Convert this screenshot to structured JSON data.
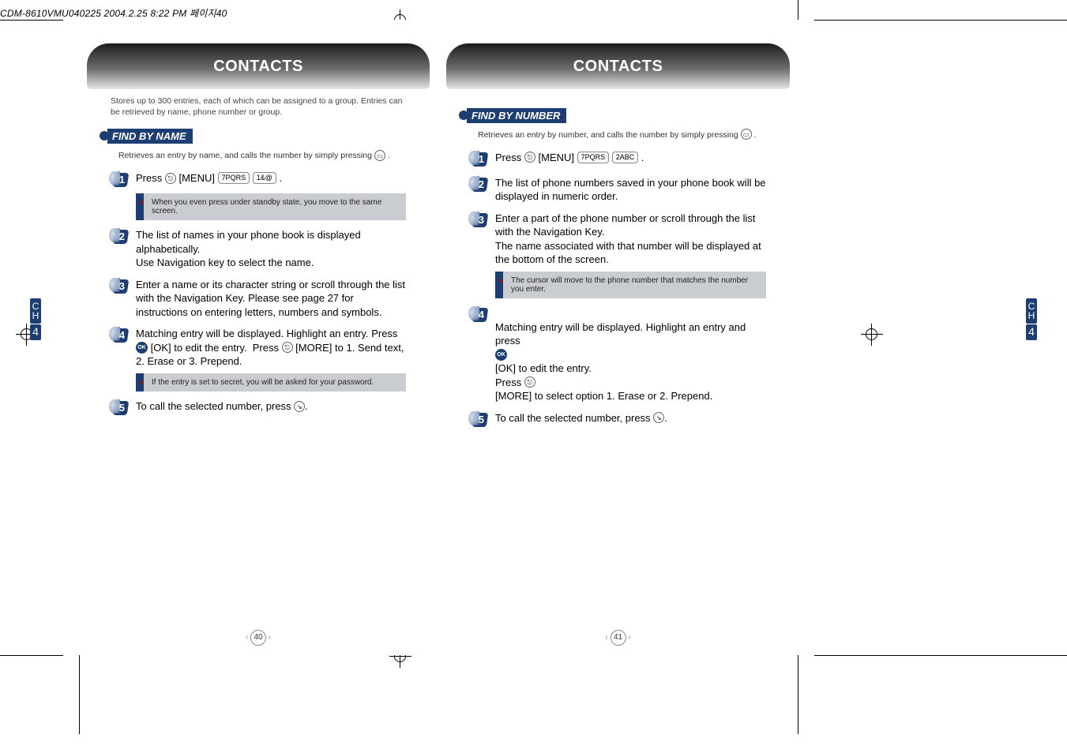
{
  "doc_header": "CDM-8610VMU040225  2004.2.25 8:22 PM  페이지40",
  "ch_label_letters": "C\nH",
  "ch_label_number": "4",
  "left": {
    "title": "CONTACTS",
    "intro": "Stores up to 300 entries, each of which can be assigned to a group. Entries can be retrieved by name, phone number or group.",
    "section": "FIND BY NAME",
    "subintro": "Retrieves an entry by name, and calls the number by simply pressing      .",
    "steps": {
      "1": "Press       [MENU]               .",
      "note1": "When you even press       under standby state, you move to the same screen.",
      "2": "The list of names in your phone book is displayed alphabetically.\nUse Navigation key to select the name.",
      "3": "Enter a name or its character string or scroll through the list with the Navigation Key. Please see page 27 for instructions on entering letters, numbers and symbols.",
      "4": "Matching entry will be displayed. Highlight an entry. Press      [OK] to edit the entry.  Press       [MORE] to 1. Send text, 2. Erase or 3. Prepend.",
      "note2": "If the entry is set to secret, you will be asked for your password.",
      "5": "To call the selected number, press      ."
    },
    "page_number": "40"
  },
  "right": {
    "title": "CONTACTS",
    "section": "FIND BY NUMBER",
    "subintro": "Retrieves an entry by number, and calls the number by simply pressing      .",
    "steps": {
      "1": "Press       [MENU]               .",
      "2": "The list of phone numbers saved in your phone book will be displayed in numeric order.",
      "3": "Enter a part of the phone number or scroll through the list with the Navigation Key.\nThe name associated with that number will be displayed at the bottom of the screen.",
      "note1": "The cursor will move to the phone number that matches the number you enter.",
      "4": "Matching entry will be displayed. Highlight an entry and press      [OK] to edit the entry.\nPress       [MORE] to select option 1. Erase or 2. Prepend.",
      "5": "To call the selected number, press      ."
    },
    "page_number": "41"
  },
  "keys": {
    "menu_soft": "⎋",
    "seven": "7PQRS",
    "one": "1&@",
    "two": "2ABC",
    "send": "↘",
    "book": "▭",
    "ok": "OK"
  }
}
